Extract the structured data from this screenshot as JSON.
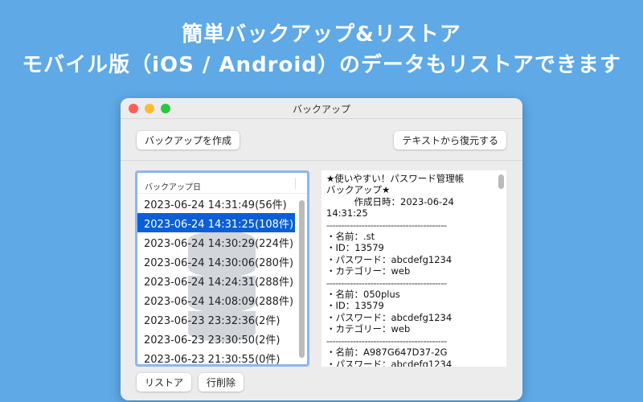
{
  "headline": {
    "line1": "簡単バックアップ&リストア",
    "line2": "モバイル版（iOS / Android）のデータもリストアできます"
  },
  "window": {
    "title": "バックアップ",
    "traffic_colors": [
      "#fe5f57",
      "#febc2e",
      "#28c840"
    ]
  },
  "toolbar": {
    "create_backup": "バックアップを作成",
    "restore_from_text": "テキストから復元する"
  },
  "list": {
    "header": "バックアップ日",
    "selected_index": 1,
    "items": [
      "2023-06-24 14:31:49(56件)",
      "2023-06-24 14:31:25(108件)",
      "2023-06-24 14:30:29(224件)",
      "2023-06-24 14:30:06(280件)",
      "2023-06-24 14:24:31(288件)",
      "2023-06-24 14:08:09(288件)",
      "2023-06-23 23:32:36(2件)",
      "2023-06-23 23:30:50(2件)",
      "2023-06-23 21:30:55(0件)"
    ]
  },
  "bottom": {
    "restore": "リストア",
    "delete_row": "行削除"
  },
  "preview": {
    "lines": [
      "★使いやすい！パスワード管理帳",
      "バックアップ★",
      "　　　作成日時：2023-06-24",
      "14:31:25",
      "-----------------------------------------",
      "・名前：.st",
      "・ID：13579",
      "・パスワード：abcdefg1234",
      "・カテゴリー：web",
      "-----------------------------------------",
      "・名前：050plus",
      "・ID：13579",
      "・パスワード：abcdefg1234",
      "・カテゴリー：web",
      "-----------------------------------------",
      "・名前：A987G647D37-2G",
      "・パスワード：abcdefg1234"
    ]
  }
}
